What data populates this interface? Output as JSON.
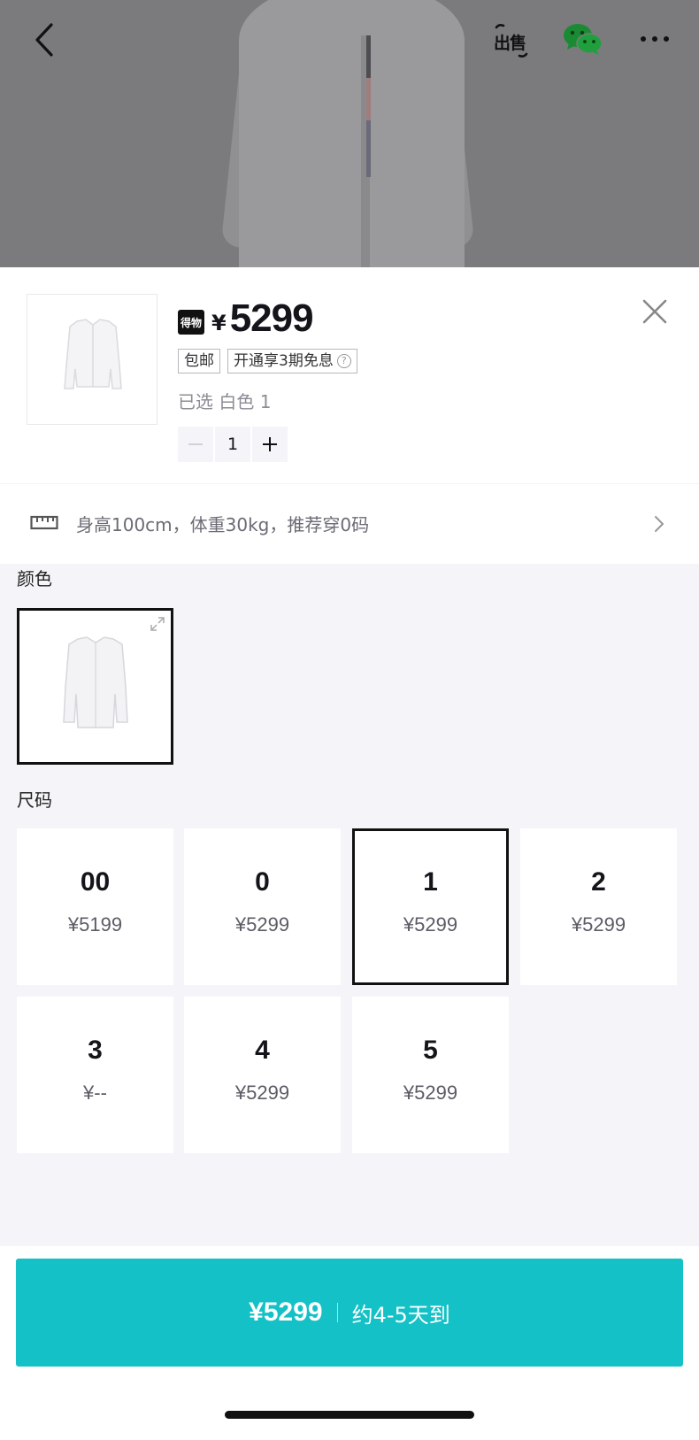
{
  "topbar": {
    "sell_label": "出售"
  },
  "product": {
    "brand_logo_text": "得物",
    "currency": "¥",
    "price": "5299",
    "tags": [
      {
        "label": "包邮"
      },
      {
        "label": "开通享3期免息"
      }
    ],
    "help_glyph": "?",
    "selected_text": "已选 白色 1",
    "quantity": "1"
  },
  "size_recommendation": {
    "text": "身高100cm，体重30kg，推荐穿0码"
  },
  "color_section": {
    "label": "颜色"
  },
  "size_section": {
    "label": "尺码",
    "sizes": [
      {
        "name": "00",
        "price": "¥5199"
      },
      {
        "name": "0",
        "price": "¥5299"
      },
      {
        "name": "1",
        "price": "¥5299",
        "selected": true
      },
      {
        "name": "2",
        "price": "¥5299"
      },
      {
        "name": "3",
        "price": "¥--"
      },
      {
        "name": "4",
        "price": "¥5299"
      },
      {
        "name": "5",
        "price": "¥5299"
      }
    ]
  },
  "buy_button": {
    "price": "¥5299",
    "eta": "约4-5天到"
  },
  "colors": {
    "accent": "#14c1c6",
    "selected_border": "#111111"
  }
}
